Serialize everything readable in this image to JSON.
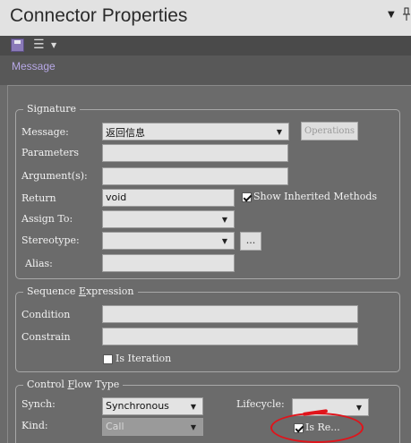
{
  "header": {
    "title": "Connector Properties",
    "pin_arrow": "▼"
  },
  "toolbar": {
    "menu_icon": "☰",
    "menu_caret": "▼"
  },
  "tabs": [
    {
      "label": "Message",
      "active": true
    }
  ],
  "signature": {
    "legend": "Signature",
    "message_label": "Message:",
    "message_value": "返回信息",
    "operations_label": "Operations",
    "parameters_label": "Parameters",
    "parameters_value": "",
    "arguments_label": "Argument(s):",
    "arguments_value": "",
    "return_label": "Return",
    "return_value": "void",
    "show_inherited_label": "Show Inherited Methods",
    "show_inherited_checked": true,
    "assign_to_label": "Assign To:",
    "assign_to_value": "",
    "stereotype_label": "Stereotype:",
    "stereotype_value": "",
    "stereotype_button": "...",
    "alias_label": "Alias:",
    "alias_value": ""
  },
  "sequence_expression": {
    "legend_pre": "Sequence ",
    "legend_underlined": "E",
    "legend_post": "xpression",
    "condition_label": "Condition",
    "condition_value": "",
    "constraint_label": "Constrain",
    "constraint_value": "",
    "is_iteration_label": "Is Iteration",
    "is_iteration_checked": false
  },
  "control_flow": {
    "legend_pre": "Control ",
    "legend_underlined": "F",
    "legend_post": "low Type",
    "synch_label": "Synch:",
    "synch_value": "Synchronous",
    "kind_label": "Kind:",
    "kind_value": "Call",
    "lifecycle_label": "Lifecycle:",
    "lifecycle_value": "",
    "is_return_label": "Is Re...",
    "is_return_checked": true
  },
  "colors": {
    "accent_tab": "#b7a8e6",
    "annotation": "#e0141b"
  }
}
